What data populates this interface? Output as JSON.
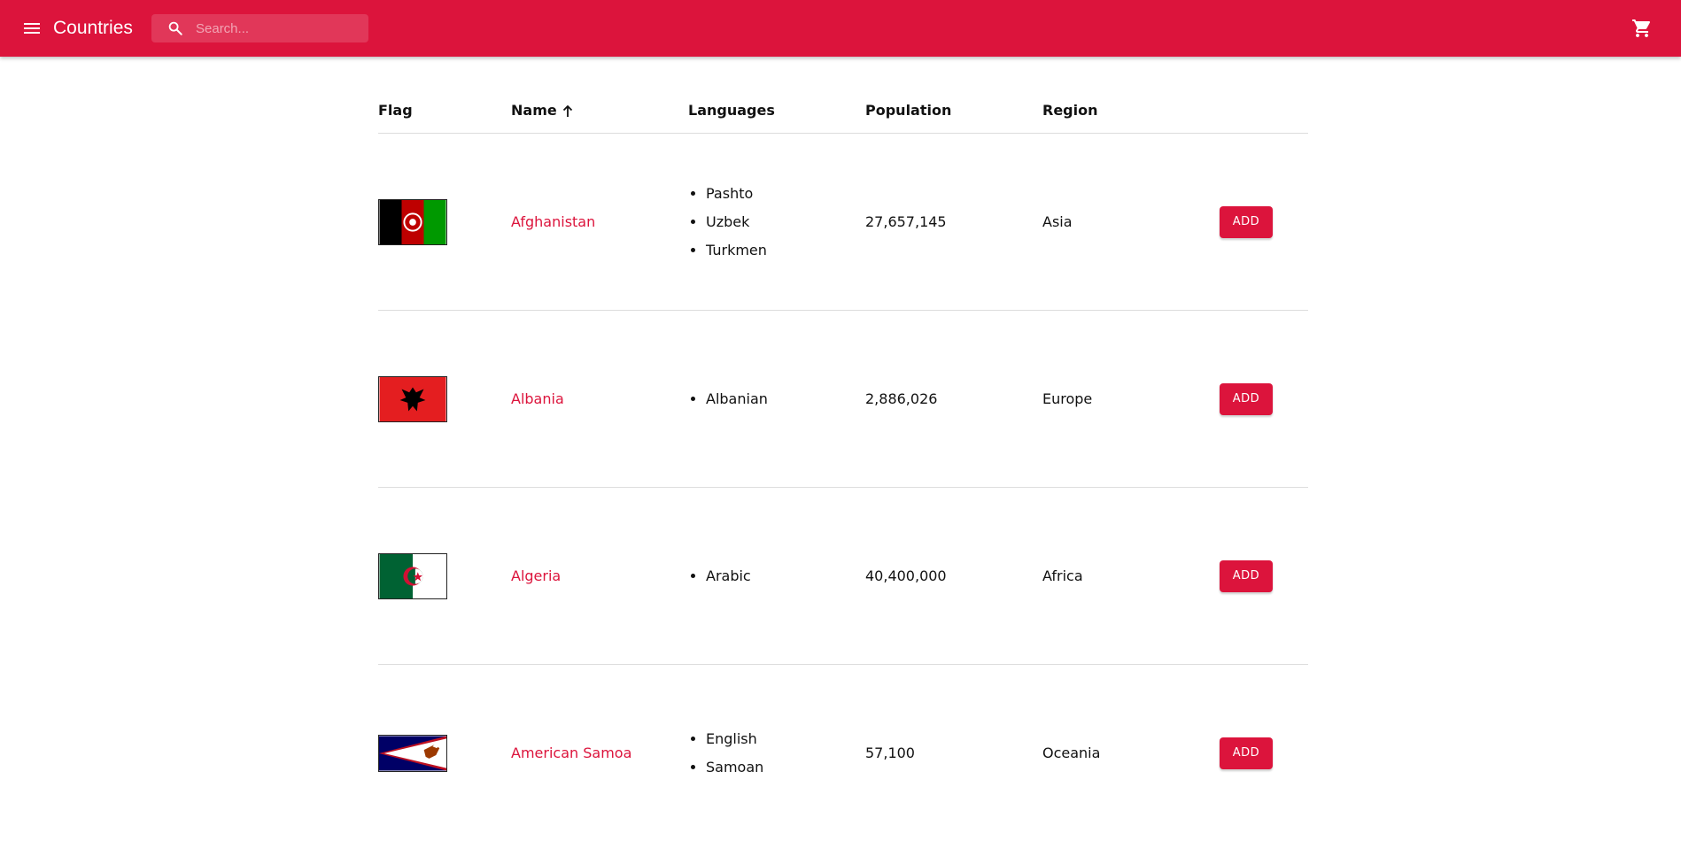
{
  "app": {
    "title": "Countries",
    "brand_color": "#dc143c",
    "search": {
      "placeholder": "Search...",
      "value": ""
    },
    "icons": {
      "menu": "menu-icon",
      "search": "search-icon",
      "cart": "shopping-cart-icon"
    }
  },
  "table": {
    "headers": {
      "flag": "Flag",
      "name": "Name",
      "languages": "Languages",
      "population": "Population",
      "region": "Region"
    },
    "sort": {
      "column": "name",
      "direction": "ascending",
      "icon": "arrow-up-icon"
    },
    "rows": [
      {
        "flag": "afghanistan-flag",
        "name": "Afghanistan",
        "languages": [
          "Pashto",
          "Uzbek",
          "Turkmen"
        ],
        "population": "27,657,145",
        "region": "Asia",
        "action": "ADD"
      },
      {
        "flag": "albania-flag",
        "name": "Albania",
        "languages": [
          "Albanian"
        ],
        "population": "2,886,026",
        "region": "Europe",
        "action": "ADD"
      },
      {
        "flag": "algeria-flag",
        "name": "Algeria",
        "languages": [
          "Arabic"
        ],
        "population": "40,400,000",
        "region": "Africa",
        "action": "ADD"
      },
      {
        "flag": "american-samoa-flag",
        "name": "American Samoa",
        "languages": [
          "English",
          "Samoan"
        ],
        "population": "57,100",
        "region": "Oceania",
        "action": "ADD"
      }
    ]
  }
}
